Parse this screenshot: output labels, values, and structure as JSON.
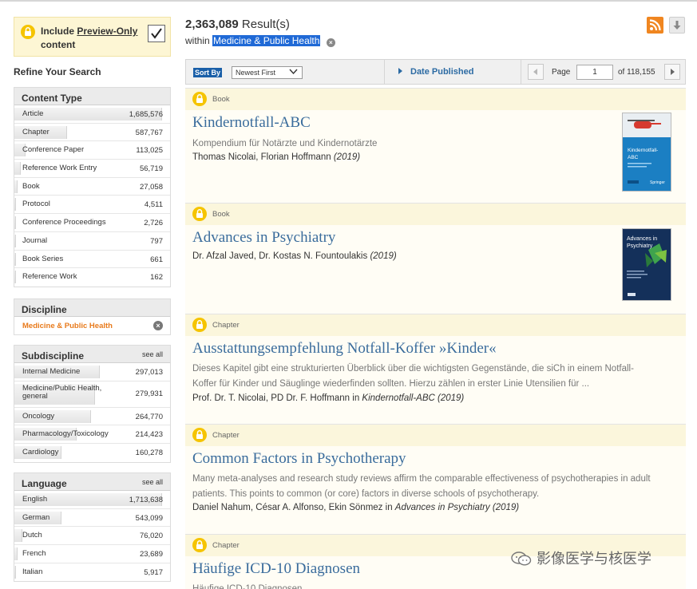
{
  "sidebar": {
    "preview_label": "Include",
    "preview_label_link": "Preview-Only",
    "preview_label_rest": "content",
    "refine_title": "Refine Your Search",
    "content_type": {
      "title": "Content Type",
      "items": [
        {
          "label": "Article",
          "count": "1,685,576",
          "pct": 0.95
        },
        {
          "label": "Chapter",
          "count": "587,767",
          "pct": 0.34
        },
        {
          "label": "Conference Paper",
          "count": "113,025",
          "pct": 0.07
        },
        {
          "label": "Reference Work Entry",
          "count": "56,719",
          "pct": 0.04
        },
        {
          "label": "Book",
          "count": "27,058",
          "pct": 0.02
        },
        {
          "label": "Protocol",
          "count": "4,511",
          "pct": 0.01
        },
        {
          "label": "Conference Proceedings",
          "count": "2,726",
          "pct": 0.01
        },
        {
          "label": "Journal",
          "count": "797",
          "pct": 0.005
        },
        {
          "label": "Book Series",
          "count": "661",
          "pct": 0.005
        },
        {
          "label": "Reference Work",
          "count": "162",
          "pct": 0.005
        }
      ]
    },
    "discipline": {
      "title": "Discipline",
      "selected": "Medicine & Public Health",
      "remove": "×"
    },
    "subdiscipline": {
      "title": "Subdiscipline",
      "see_all": "see all",
      "items": [
        {
          "label": "Internal Medicine",
          "count": "297,013",
          "pct": 0.55
        },
        {
          "label": "Medicine/Public Health, general",
          "count": "279,931",
          "pct": 0.52
        },
        {
          "label": "Oncology",
          "count": "264,770",
          "pct": 0.49
        },
        {
          "label": "Pharmacology/Toxicology",
          "count": "214,423",
          "pct": 0.4
        },
        {
          "label": "Cardiology",
          "count": "160,278",
          "pct": 0.3
        }
      ]
    },
    "language": {
      "title": "Language",
      "see_all": "see all",
      "items": [
        {
          "label": "English",
          "count": "1,713,638",
          "pct": 0.95
        },
        {
          "label": "German",
          "count": "543,099",
          "pct": 0.3
        },
        {
          "label": "Dutch",
          "count": "76,020",
          "pct": 0.05
        },
        {
          "label": "French",
          "count": "23,689",
          "pct": 0.02
        },
        {
          "label": "Italian",
          "count": "5,917",
          "pct": 0.01
        }
      ]
    }
  },
  "results": {
    "count": "2,363,089",
    "count_suffix": "Result(s)",
    "within_label": "within",
    "within_value": "Medicine & Public Health",
    "remove": "×"
  },
  "sortbar": {
    "sort_by": "Sort By",
    "sort_value": "Newest First",
    "date_published": "Date Published",
    "page_label": "Page",
    "page_value": "1",
    "page_of": "of 118,155"
  },
  "cards": [
    {
      "type": "Book",
      "title": "Kindernotfall-ABC",
      "desc": "Kompendium für Notärzte und Kindernotärzte",
      "authors": "Thomas Nicolai, Florian Hoffmann",
      "year": "(2019)",
      "cover_title": "Kindernotfall-ABC"
    },
    {
      "type": "Book",
      "title": "Advances in Psychiatry",
      "authors": "Dr. Afzal Javed, Dr. Kostas N. Fountoulakis",
      "year": "(2019)",
      "cover_title": "Advances in Psychiatry"
    },
    {
      "type": "Chapter",
      "title": "Ausstattungsempfehlung Notfall-Koffer »Kinder«",
      "desc": "Dieses Kapitel gibt eine strukturierten Überblick über die wichtigsten Gegenstände, die siCh in einem Notfall-Koffer für Kinder und Säuglinge wiederfinden sollten. Hierzu zählen in erster Linie Utensilien für ...",
      "authors": "Prof. Dr. T. Nicolai, PD Dr. F. Hoffmann",
      "in_word": "in",
      "source": "Kindernotfall-ABC (2019)"
    },
    {
      "type": "Chapter",
      "title": "Common Factors in Psychotherapy",
      "desc": "Many meta-analyses and research study reviews affirm the comparable effectiveness of psychotherapies in adult patients. This points to common (or core) factors in diverse schools of psychotherapy.",
      "authors": "Daniel Nahum, César A. Alfonso, Ekin Sönmez",
      "in_word": "in",
      "source": "Advances in Psychiatry (2019)"
    },
    {
      "type": "Chapter",
      "title": "Häufige ICD-10 Diagnosen",
      "desc": "Häufige ICD-10 Diagnosen"
    }
  ],
  "watermark": "影像医学与核医学",
  "colors": {
    "link": "#3a6c9c",
    "accent_orange": "#e87a1b",
    "highlight_blue": "#1f69d6",
    "card_band": "#fbf6dc",
    "lock_yellow": "#f5c400"
  }
}
